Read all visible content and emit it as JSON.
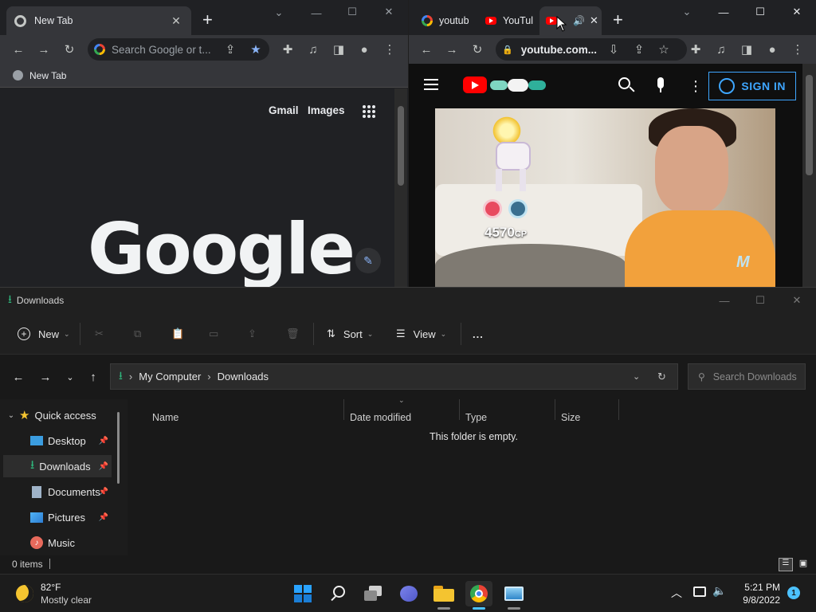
{
  "chrome_left": {
    "tab_title": "New Tab",
    "omnibox_placeholder": "Search Google or t...",
    "bookmark_label": "New Tab",
    "ntp": {
      "gmail": "Gmail",
      "images": "Images",
      "logo": "Google"
    }
  },
  "chrome_right": {
    "tabs": [
      {
        "label": "youtub",
        "icon": "google-icon"
      },
      {
        "label": "YouTul",
        "icon": "youtube-icon"
      },
      {
        "label": "",
        "icon": "youtube-icon",
        "audio": true,
        "active": true
      }
    ],
    "url": "youtube.com...",
    "youtube": {
      "sign_in": "SIGN IN",
      "video_overlay": {
        "cp_text": "4570",
        "cp_suffix": "CP"
      }
    }
  },
  "explorer": {
    "title": "Downloads",
    "commands": {
      "new": "New",
      "sort": "Sort",
      "view": "View",
      "more": "..."
    },
    "breadcrumb": [
      "My Computer",
      "Downloads"
    ],
    "search_placeholder": "Search Downloads",
    "nav_pane": [
      {
        "label": "Quick access",
        "icon": "star-icon"
      },
      {
        "label": "Desktop",
        "icon": "desktop-icon",
        "pinned": true
      },
      {
        "label": "Downloads",
        "icon": "download-icon",
        "pinned": true,
        "selected": true
      },
      {
        "label": "Documents",
        "icon": "documents-icon",
        "pinned": true
      },
      {
        "label": "Pictures",
        "icon": "pictures-icon",
        "pinned": true
      },
      {
        "label": "Music",
        "icon": "music-icon"
      }
    ],
    "columns": [
      "Name",
      "Date modified",
      "Type",
      "Size"
    ],
    "empty_message": "This folder is empty.",
    "status": "0 items"
  },
  "taskbar": {
    "weather": {
      "temp": "82°F",
      "condition": "Mostly clear"
    },
    "apps": [
      "start-icon",
      "search-icon",
      "task-view-icon",
      "chat-icon",
      "file-explorer-icon",
      "chrome-icon",
      "control-panel-icon"
    ],
    "clock": {
      "time": "5:21 PM",
      "date": "9/8/2022"
    },
    "notification_count": "1"
  },
  "colors": {
    "accent_blue": "#3ea6ff",
    "youtube_red": "#ff0000",
    "downloads_green": "#2fb67c"
  }
}
